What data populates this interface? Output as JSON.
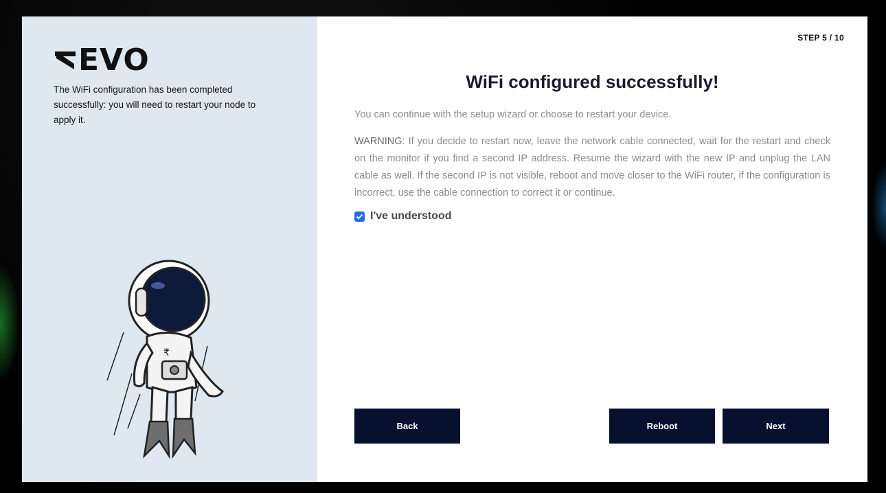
{
  "brand": {
    "name": "EVO",
    "logo_mark": "revo-r-chevron-icon"
  },
  "left_panel": {
    "description": "The WiFi configuration has been completed successfully: you will need to restart your node to apply it.",
    "illustration": "astronaut-illustration"
  },
  "header": {
    "step": "STEP 5 / 10"
  },
  "main": {
    "title": "WiFi configured successfully!",
    "intro": "You can continue with the setup wizard or choose to restart your device.",
    "warning_label": "WARNING:",
    "warning_text": " If you decide to restart now, leave the network cable connected, wait for the restart and check on the monitor if you find a second IP address. Resume the wizard with the new IP and unplug the LAN cable as well. If the second IP is not visible, reboot and move closer to the WiFi router, if the configuration is incorrect, use the cable connection to correct it or continue.",
    "checkbox": {
      "label": "I've understood",
      "checked": true,
      "icon": "checkmark-icon"
    }
  },
  "buttons": {
    "back": "Back",
    "reboot": "Reboot",
    "next": "Next"
  },
  "colors": {
    "left_panel_bg": "#dfe8f1",
    "button_bg": "#07102e",
    "checkbox_accent": "#1f6fe0",
    "muted_text": "#8c8c8c"
  }
}
